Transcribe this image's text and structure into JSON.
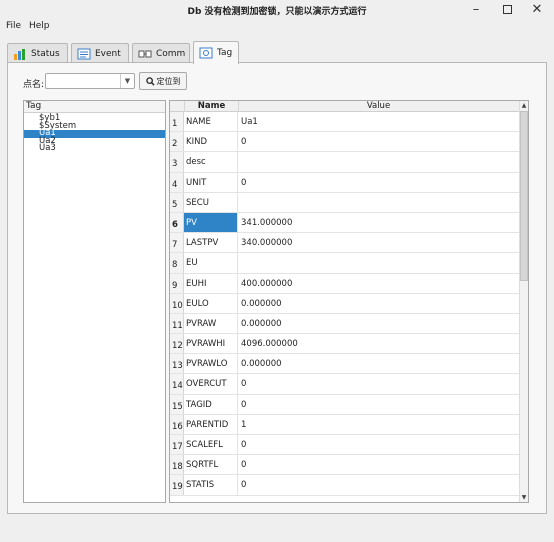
{
  "window": {
    "title": "Db 没有检测到加密锁，只能以演示方式运行",
    "minimize_icon": "minimize-icon",
    "maximize_icon": "maximize-icon",
    "close_icon": "close-icon"
  },
  "menu": {
    "file": "File",
    "help": "Help"
  },
  "tabs": [
    {
      "label": "Status",
      "icon": "status-icon",
      "active": false
    },
    {
      "label": "Event",
      "icon": "event-icon",
      "active": false
    },
    {
      "label": "Comm",
      "icon": "comm-icon",
      "active": false
    },
    {
      "label": "Tag",
      "icon": "tag-icon",
      "active": true
    }
  ],
  "search": {
    "label": "点名:",
    "value": "",
    "button_label": "定位到"
  },
  "tree": {
    "header": "Tag",
    "items": [
      "$yb1",
      "$System",
      "Ua1",
      "Ua2",
      "Ua3"
    ],
    "selected": "Ua1"
  },
  "grid": {
    "headers": {
      "name": "Name",
      "value": "Value"
    },
    "rows": [
      {
        "num": "1",
        "name": "NAME",
        "value": "Ua1"
      },
      {
        "num": "2",
        "name": "KIND",
        "value": "0"
      },
      {
        "num": "3",
        "name": "desc",
        "value": ""
      },
      {
        "num": "4",
        "name": "UNIT",
        "value": "0"
      },
      {
        "num": "5",
        "name": "SECU",
        "value": ""
      },
      {
        "num": "6",
        "name": "PV",
        "value": "341.000000"
      },
      {
        "num": "7",
        "name": "LASTPV",
        "value": "340.000000"
      },
      {
        "num": "8",
        "name": "EU",
        "value": ""
      },
      {
        "num": "9",
        "name": "EUHI",
        "value": "400.000000"
      },
      {
        "num": "10",
        "name": "EULO",
        "value": "0.000000"
      },
      {
        "num": "11",
        "name": "PVRAW",
        "value": "0.000000"
      },
      {
        "num": "12",
        "name": "PVRAWHI",
        "value": "4096.000000"
      },
      {
        "num": "13",
        "name": "PVRAWLO",
        "value": "0.000000"
      },
      {
        "num": "14",
        "name": "OVERCUT",
        "value": "0"
      },
      {
        "num": "15",
        "name": "TAGID",
        "value": "0"
      },
      {
        "num": "16",
        "name": "PARENTID",
        "value": "1"
      },
      {
        "num": "17",
        "name": "SCALEFL",
        "value": "0"
      },
      {
        "num": "18",
        "name": "SQRTFL",
        "value": "0"
      },
      {
        "num": "19",
        "name": "STATIS",
        "value": "0"
      }
    ],
    "selected_row": "6"
  },
  "colors": {
    "selection": "#2f84c8"
  }
}
